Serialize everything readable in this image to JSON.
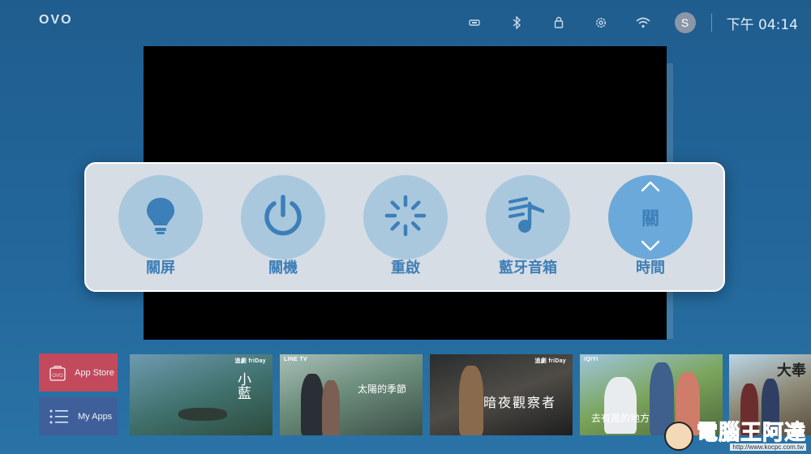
{
  "brand": {
    "logo_text": "OVO"
  },
  "status_bar": {
    "icons": [
      "storage-icon",
      "bluetooth-icon",
      "lock-icon",
      "gear-icon",
      "wifi-icon"
    ],
    "avatar_letter": "S",
    "clock": "下午 04:14"
  },
  "menu": {
    "items": [
      {
        "label": "關屏",
        "icon": "lightbulb-icon"
      },
      {
        "label": "關機",
        "icon": "power-icon"
      },
      {
        "label": "重啟",
        "icon": "loading-spinner-icon"
      },
      {
        "label": "藍牙音箱",
        "icon": "music-note-icon"
      },
      {
        "label": "時間",
        "icon": "chevron-up-down-icon",
        "value": "關"
      }
    ]
  },
  "apps": {
    "app_store": "App Store",
    "my_apps": "My Apps"
  },
  "posters": [
    {
      "badge": "追劇 friDay",
      "title": "小藍"
    },
    {
      "badge": "LINE TV",
      "title": "太陽的季節"
    },
    {
      "badge": "追劇 friDay",
      "title": "暗夜觀察者"
    },
    {
      "badge": "iQIYI",
      "title": "去有風的地方"
    },
    {
      "badge": "",
      "title": "大奉"
    }
  ],
  "watermark": {
    "name": "電腦王阿達",
    "url": "http://www.kocpc.com.tw"
  },
  "colors": {
    "accent": "#3d7fb8",
    "circle": "#a9c8dd",
    "circle_active": "#6aa9d9",
    "panel": "#d7dde4"
  }
}
